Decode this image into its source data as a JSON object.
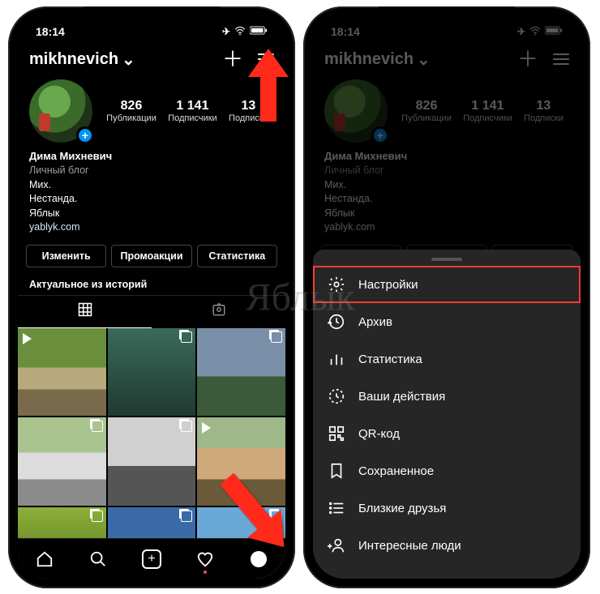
{
  "status": {
    "time": "18:14"
  },
  "header": {
    "username": "mikhnevich"
  },
  "stats": {
    "posts": {
      "n": "826",
      "l": "Публикации"
    },
    "followers": {
      "n": "1 141",
      "l": "Подписчики"
    },
    "following": {
      "n": "13",
      "l": "Подписки"
    }
  },
  "bio": {
    "name": "Дима Михневич",
    "category": "Личный блог",
    "line1": "Мих.",
    "line2": "Нестанда.",
    "line3": "Яблык",
    "link": "yablyk.com"
  },
  "buttons": {
    "edit": "Изменить",
    "promo": "Промоакции",
    "stats": "Статистика"
  },
  "highlights_label": "Актуальное из историй",
  "sheet": {
    "settings": "Настройки",
    "archive": "Архив",
    "stats": "Статистика",
    "activity": "Ваши действия",
    "qr": "QR-код",
    "saved": "Сохраненное",
    "close": "Близкие друзья",
    "discover": "Интересные люди"
  },
  "watermark": "Яблык"
}
